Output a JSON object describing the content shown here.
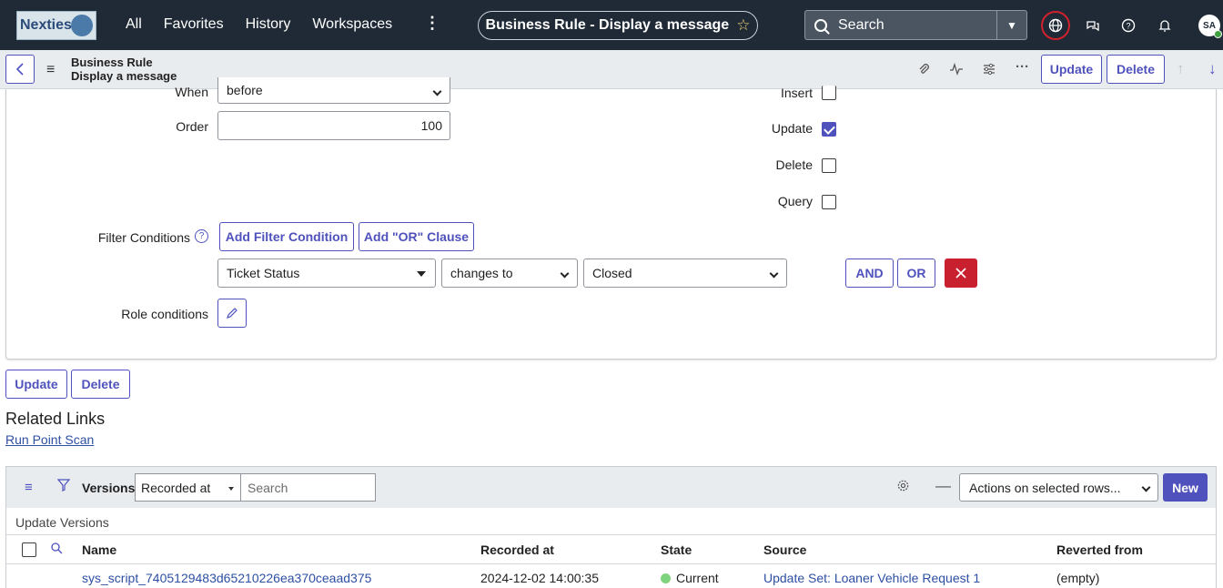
{
  "topnav": {
    "logo_text": "Nexties",
    "links": [
      "All",
      "Favorites",
      "History",
      "Workspaces"
    ],
    "more": "⋮",
    "record_title": "Business Rule - Display a message",
    "search_placeholder": "Search",
    "avatar_initials": "SA"
  },
  "form_header": {
    "title_line1": "Business Rule",
    "title_line2": "Display a message",
    "update_label": "Update",
    "delete_label": "Delete"
  },
  "form": {
    "when_label": "When",
    "when_value": "before",
    "order_label": "Order",
    "order_value": "100",
    "insert_label": "Insert",
    "insert_checked": false,
    "update_label": "Update",
    "update_checked": true,
    "delete_label": "Delete",
    "delete_checked": false,
    "query_label": "Query",
    "query_checked": false,
    "filter_conditions_label": "Filter Conditions",
    "add_filter_label": "Add Filter Condition",
    "add_or_label": "Add \"OR\" Clause",
    "condition": {
      "field": "Ticket Status",
      "operator": "changes to",
      "value": "Closed"
    },
    "and_label": "AND",
    "or_label": "OR",
    "role_conditions_label": "Role conditions",
    "accent_color": "#4f52bd",
    "danger_color": "#c8202f"
  },
  "bottom_buttons": {
    "update_label": "Update",
    "delete_label": "Delete"
  },
  "related": {
    "heading": "Related Links",
    "link": "Run Point Scan"
  },
  "versions": {
    "title": "Versions",
    "search_field": "Recorded at",
    "search_placeholder": "Search",
    "actions_placeholder": "Actions on selected rows...",
    "new_label": "New",
    "subtitle": "Update Versions",
    "columns": [
      "Name",
      "Recorded at",
      "State",
      "Source",
      "Reverted from"
    ],
    "rows": [
      {
        "name": "sys_script_7405129483d65210226ea370ceaad375",
        "recorded_at": "2024-12-02 14:00:35",
        "state": "Current",
        "source": "Update Set: Loaner Vehicle Request 1",
        "reverted_from": "(empty)"
      }
    ]
  }
}
